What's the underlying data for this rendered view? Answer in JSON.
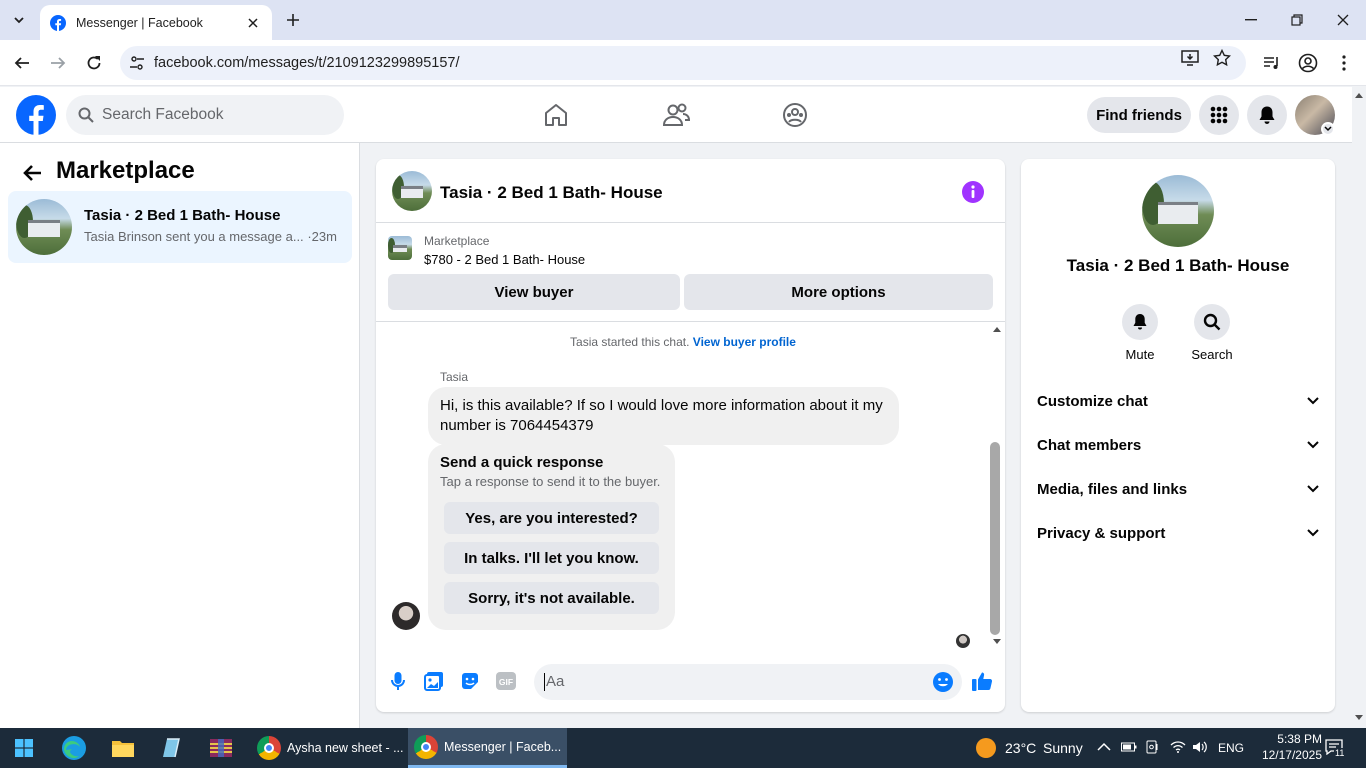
{
  "browser": {
    "tab_title": "Messenger | Facebook",
    "url": "facebook.com/messages/t/2109123299895157/"
  },
  "fb": {
    "search_placeholder": "Search Facebook",
    "find_friends": "Find friends"
  },
  "sidebar": {
    "title": "Marketplace",
    "conversation": {
      "name": "Tasia · 2 Bed 1 Bath- House",
      "preview": "Tasia Brinson sent you a message a...",
      "time": "·23m"
    }
  },
  "chat": {
    "title": "Tasia · 2 Bed 1 Bath- House",
    "listing": {
      "category": "Marketplace",
      "price_title": "$780 - 2 Bed 1 Bath- House",
      "view_buyer": "View buyer",
      "more_options": "More options"
    },
    "started_text": "Tasia started this chat.",
    "view_buyer_profile": "View buyer profile",
    "sender": "Tasia",
    "message": "Hi, is this available? If so I would love more information about it my number is 7064454379",
    "quick": {
      "title": "Send a quick response",
      "subtitle": "Tap a response to send it to the buyer.",
      "options": [
        "Yes, are you interested?",
        "In talks. I'll let you know.",
        "Sorry, it's not available."
      ]
    },
    "composer_placeholder": "Aa"
  },
  "details": {
    "name": "Tasia · 2 Bed 1 Bath- House",
    "mute": "Mute",
    "search": "Search",
    "sections": [
      "Customize chat",
      "Chat members",
      "Media, files and links",
      "Privacy & support"
    ]
  },
  "taskbar": {
    "app1": "Aysha new sheet - ...",
    "app2": "Messenger | Faceb...",
    "weather_temp": "23°C",
    "weather_desc": "Sunny",
    "lang": "ENG",
    "time": "5:38 PM",
    "date": "12/17/2025",
    "notif_count": "11"
  },
  "colors": {
    "fb_blue": "#0866ff",
    "link_blue": "#0064d1",
    "info_purple": "#a033ff",
    "composer_blue": "#0a7cff"
  }
}
